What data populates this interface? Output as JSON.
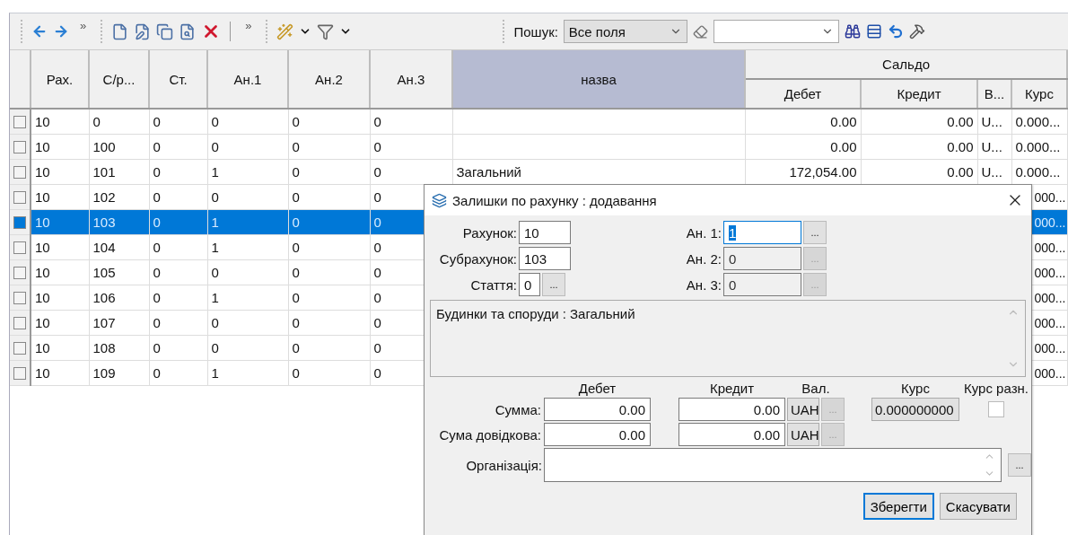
{
  "toolbar": {
    "search_label": "Пошук:",
    "search_scope": "Все поля",
    "overflow": [
      "»",
      "»"
    ]
  },
  "table": {
    "columns": [
      {
        "label": "Рах.",
        "selected": false
      },
      {
        "label": "С/р...",
        "selected": false
      },
      {
        "label": "Ст.",
        "selected": false
      },
      {
        "label": "Ан.1",
        "selected": false
      },
      {
        "label": "Ан.2",
        "selected": false
      },
      {
        "label": "Ан.3",
        "selected": false
      },
      {
        "label": "назва",
        "selected": true
      }
    ],
    "group": {
      "label": "Сальдо",
      "columns": [
        "Дебет",
        "Кредит",
        "В...",
        "Курс"
      ]
    },
    "rows": [
      {
        "selected": false,
        "cells": [
          "10",
          "0",
          "0",
          "0",
          "0",
          "0"
        ],
        "debit": "0.00",
        "credit": "0.00",
        "currency": "U...",
        "rate": "0.000..."
      },
      {
        "selected": false,
        "cells": [
          "10",
          "100",
          "0",
          "0",
          "0",
          "0"
        ],
        "debit": "0.00",
        "credit": "0.00",
        "currency": "U...",
        "rate": "0.000..."
      },
      {
        "selected": false,
        "cells": [
          "10",
          "101",
          "0",
          "1",
          "0",
          "0"
        ],
        "name": "Загальний",
        "debit": "172,054.00",
        "credit": "0.00",
        "currency": "U...",
        "rate": "0.000..."
      },
      {
        "selected": false,
        "cells": [
          "10",
          "102",
          "0",
          "0",
          "0",
          "0"
        ],
        "rate": "000..."
      },
      {
        "selected": true,
        "cells": [
          "10",
          "103",
          "0",
          "1",
          "0",
          "0"
        ],
        "rate": "000..."
      },
      {
        "selected": false,
        "cells": [
          "10",
          "104",
          "0",
          "1",
          "0",
          "0"
        ],
        "rate": "000..."
      },
      {
        "selected": false,
        "cells": [
          "10",
          "105",
          "0",
          "0",
          "0",
          "0"
        ],
        "rate": "000..."
      },
      {
        "selected": false,
        "cells": [
          "10",
          "106",
          "0",
          "1",
          "0",
          "0"
        ],
        "rate": "000..."
      },
      {
        "selected": false,
        "cells": [
          "10",
          "107",
          "0",
          "0",
          "0",
          "0"
        ],
        "rate": "000..."
      },
      {
        "selected": false,
        "cells": [
          "10",
          "108",
          "0",
          "0",
          "0",
          "0"
        ],
        "rate": "000..."
      },
      {
        "selected": false,
        "cells": [
          "10",
          "109",
          "0",
          "1",
          "0",
          "0"
        ],
        "rate": "000..."
      }
    ]
  },
  "dialog": {
    "title": "Залишки по рахунку : додавання",
    "left_fields": [
      {
        "label": "Рахунок:",
        "value": "10",
        "kind": "plain"
      },
      {
        "label": "Субрахунок:",
        "value": "103",
        "kind": "plain"
      },
      {
        "label": "Стаття:",
        "value": "0",
        "kind": "lookup"
      }
    ],
    "right_fields": [
      {
        "label": "Ан. 1:",
        "value": "1",
        "disabled": false
      },
      {
        "label": "Ан. 2:",
        "value": "0",
        "disabled": true
      },
      {
        "label": "Ан. 3:",
        "value": "0",
        "disabled": true
      }
    ],
    "description": "Будинки та споруди : Загальний",
    "amount_headers": [
      "Дебет",
      "Кредит",
      "Вал.",
      "Курс",
      "Курс разн."
    ],
    "amount_rows": [
      {
        "label": "Сумма:",
        "debit": "0.00",
        "credit": "0.00",
        "currency": "UAH",
        "rate": "0.000000000",
        "rate_diff_checked": false
      },
      {
        "label": "Сума довідкова:",
        "debit": "0.00",
        "credit": "0.00",
        "currency": "UAH"
      }
    ],
    "organization": {
      "label": "Організація:"
    },
    "ellipsis": "...",
    "buttons": [
      {
        "label": "Зберегти",
        "default": true
      },
      {
        "label": "Скасувати",
        "default": false
      }
    ]
  }
}
